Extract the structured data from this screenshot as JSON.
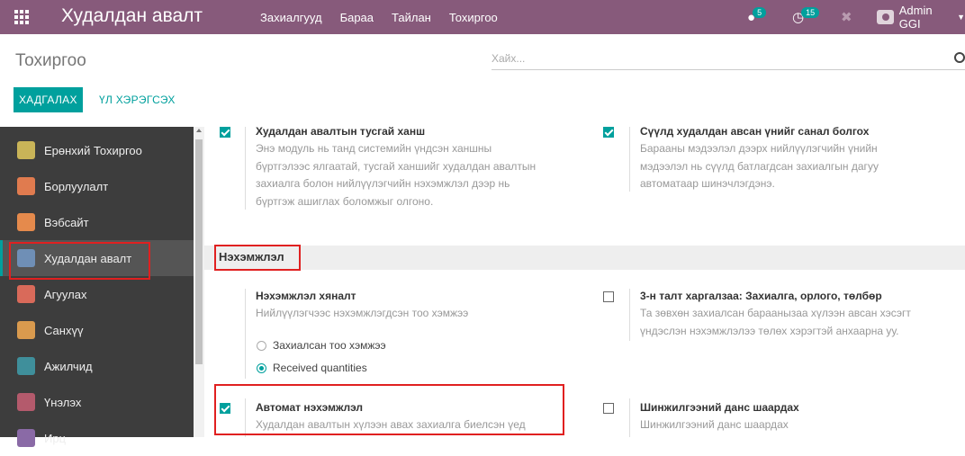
{
  "navbar": {
    "brand": "Худалдан авалт",
    "menu": [
      "Захиалгууд",
      "Бараа",
      "Тайлан",
      "Тохиргоо"
    ],
    "messages_count": "5",
    "activities_count": "15",
    "user": "Admin GGI",
    "colors": {
      "bar": "#875a7b",
      "accent": "#00a09d"
    }
  },
  "control": {
    "title": "Тохиргоо",
    "search_placeholder": "Хайх...",
    "save_label": "ХАДГАЛАХ",
    "discard_label": "ҮЛ ХЭРЭГСЭХ"
  },
  "sidebar": {
    "items": [
      {
        "label": "Ерөнхий Тохиргоо",
        "icon": "gear-icon"
      },
      {
        "label": "Борлуулалт",
        "icon": "chart-icon"
      },
      {
        "label": "Вэбсайт",
        "icon": "globe-icon"
      },
      {
        "label": "Худалдан авалт",
        "icon": "credit-card-icon"
      },
      {
        "label": "Агуулах",
        "icon": "boxes-icon"
      },
      {
        "label": "Санхүү",
        "icon": "dollar-icon"
      },
      {
        "label": "Ажилчид",
        "icon": "people-icon"
      },
      {
        "label": "Үнэлэх",
        "icon": "star-icon"
      },
      {
        "label": "Ирц",
        "icon": "clock-icon"
      }
    ]
  },
  "settings": {
    "vendor_pricelist": {
      "title": "Худалдан авалтын тусгай ханш",
      "desc": [
        "Энэ модуль нь танд системийн үндсэн ханшны",
        "бүртгэлээс ялгаатай, тусгай ханшийг худалдан авалтын",
        "захиалга болон нийлүүлэгчийн нэхэмжлэл дээр нь",
        "бүртгэж ашиглах боломжыг олгоно."
      ]
    },
    "last_price": {
      "title": "Сүүлд худалдан авсан үнийг санал болгох",
      "desc": [
        "Барааны мэдээлэл дээрх нийлүүлэгчийн үнийн",
        "мэдээлэл нь сүүлд батлагдсан захиалгын дагуу",
        "автоматаар шинэчлэгдэнэ."
      ]
    },
    "section_invoicing": "Нэхэмжлэл",
    "bill_control": {
      "title": "Нэхэмжлэл хяналт",
      "desc": "Нийлүүлэгчээс нэхэмжлэгдсэн тоо хэмжээ",
      "options": [
        "Захиалсан тоо хэмжээ",
        "Received quantities"
      ]
    },
    "three_way": {
      "title": "3-н талт харгалзаа: Захиалга, орлого, төлбөр",
      "desc": [
        "Та зөвхөн захиалсан бараанызаа хүлээн авсан хэсэгт",
        "үндэслэн нэхэмжлэлээ төлөх хэрэгтэй анхаарна уу."
      ]
    },
    "auto_invoice": {
      "title": "Автомат нэхэмжлэл",
      "desc": "Худалдан авалтын хүлээн авах захиалга биелсэн үед"
    },
    "analytic": {
      "title": "Шинжилгээний данс шаардах",
      "desc": "Шинжилгээний данс шаардах"
    }
  }
}
